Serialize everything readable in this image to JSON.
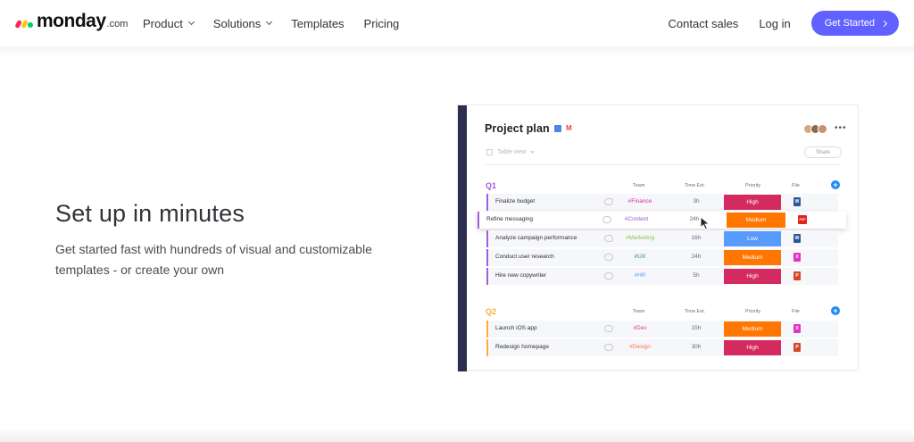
{
  "header": {
    "logo_text": "monday",
    "logo_suffix": ".com",
    "nav_left": [
      {
        "label": "Product",
        "has_dropdown": true
      },
      {
        "label": "Solutions",
        "has_dropdown": true
      },
      {
        "label": "Templates",
        "has_dropdown": false
      },
      {
        "label": "Pricing",
        "has_dropdown": false
      }
    ],
    "contact_sales": "Contact sales",
    "login": "Log in",
    "cta": "Get Started"
  },
  "hero": {
    "title": "Set up in minutes",
    "subtitle": "Get started fast with hundreds of visual and customizable templates - or create your own"
  },
  "board": {
    "title": "Project plan",
    "view_label": "Table view",
    "share_label": "Share",
    "columns": {
      "team": "Team",
      "time": "Time Est.",
      "priority": "Priority",
      "file": "File"
    },
    "groups": [
      {
        "name": "Q1",
        "color": "#a25ddc",
        "rows": [
          {
            "name": "Finalize budget",
            "team": "#Finance",
            "team_color": "#c42ea6",
            "time": "3h",
            "priority": "High",
            "priority_color": "#d32b5f",
            "file": "W",
            "file_color": "#2b579a"
          },
          {
            "name": "Refine messaging",
            "team": "#Content",
            "team_color": "#9b59d0",
            "time": "24h",
            "priority": "Medium",
            "priority_color": "#ff7700",
            "file": "PDF",
            "file_color": "#e2231a",
            "dragging": true
          },
          {
            "name": "Analyze campaign performance",
            "team": "#Marketing",
            "team_color": "#8bc34a",
            "time": "16h",
            "priority": "Low",
            "priority_color": "#579bfc",
            "file": "W",
            "file_color": "#2b579a"
          },
          {
            "name": "Conduct user research",
            "team": "#UX",
            "team_color": "#1b8f5c",
            "time": "24h",
            "priority": "Medium",
            "priority_color": "#ff7700",
            "file": "X",
            "file_color": "#e233c6"
          },
          {
            "name": "Hire new copywriter",
            "team": "#HR",
            "team_color": "#579bfc",
            "time": "5h",
            "priority": "High",
            "priority_color": "#d32b5f",
            "file": "P",
            "file_color": "#d24726"
          }
        ]
      },
      {
        "name": "Q2",
        "color": "#fdab3d",
        "rows": [
          {
            "name": "Launch iOS app",
            "team": "#Dev",
            "team_color": "#e2445c",
            "time": "15h",
            "priority": "Medium",
            "priority_color": "#ff7700",
            "file": "X",
            "file_color": "#e233c6"
          },
          {
            "name": "Redesign homepage",
            "team": "#Design",
            "team_color": "#f2774e",
            "time": "30h",
            "priority": "High",
            "priority_color": "#d32b5f",
            "file": "P",
            "file_color": "#d24726"
          }
        ]
      }
    ]
  }
}
